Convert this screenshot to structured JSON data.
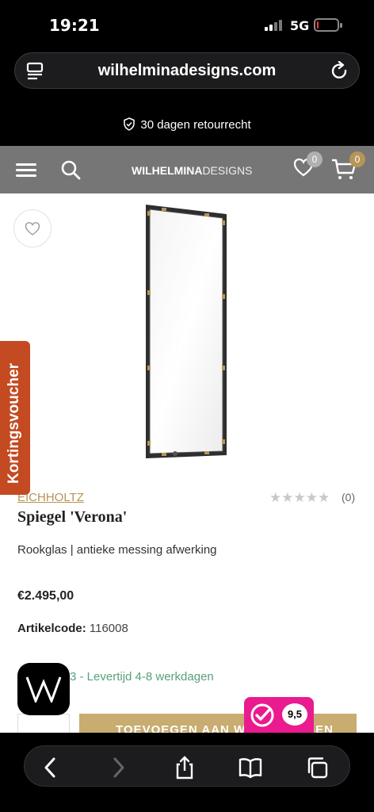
{
  "status_bar": {
    "time": "19:21",
    "network": "5G",
    "battery_level_fraction": 0.1,
    "battery_color": "#ff3b30"
  },
  "browser": {
    "url": "wilhelminadesigns.com",
    "page_icon": "page-menu-icon",
    "reload_icon": "reload-icon"
  },
  "notice": {
    "icon": "shield-check-icon",
    "text": "30 dagen retourrecht"
  },
  "header": {
    "logo_bold": "WILHELMINA",
    "logo_light": "DESIGNS",
    "favorites_count": "0",
    "cart_count": "0",
    "accent_color": "#b79557",
    "header_color": "#767676"
  },
  "product": {
    "brand": "EICHHOLTZ",
    "rating_stars": 0,
    "review_count": "(0)",
    "title": "Spiegel 'Verona'",
    "subtitle": "Rookglas | antieke messing afwerking",
    "price": "€2.495,00",
    "article_label": "Artikelcode:",
    "article_code": "116008",
    "stock_text": "3 - Levertijd 4-8 werkdagen",
    "stock_color": "#58a07b",
    "add_to_cart": "TOEVOEGEN AAN WINKELWAGEN"
  },
  "voucher": {
    "label": "Kortingsvoucher",
    "color": "#c44a22"
  },
  "rating_widget": {
    "score": "9,5",
    "color": "#ea1b8f"
  },
  "toolbar": {
    "back_icon": "chevron-left-icon",
    "forward_icon": "chevron-right-icon",
    "share_icon": "share-icon",
    "bookmarks_icon": "book-icon",
    "tabs_icon": "tabs-icon"
  }
}
